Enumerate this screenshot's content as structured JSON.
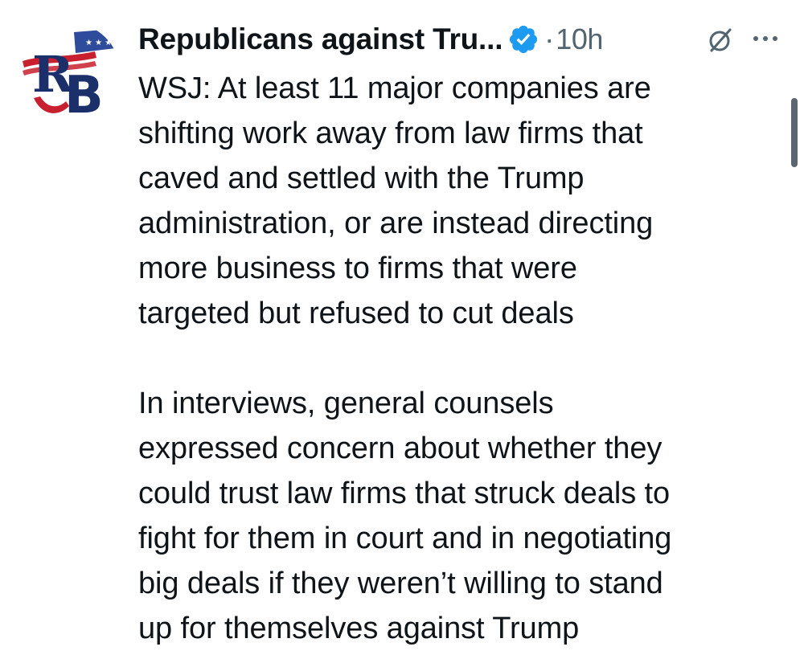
{
  "tweet": {
    "author": {
      "display_name": "Republicans against Tru...",
      "verified": true,
      "avatar_icon": "rb-logo-avatar",
      "avatar_text": "RB"
    },
    "meta": {
      "separator": "·",
      "timestamp": "10h"
    },
    "icons": {
      "verified": "verified-badge-icon",
      "grok": "grok-icon",
      "more": "more-options-icon"
    },
    "body": {
      "paragraphs": [
        "WSJ: At least 11 major companies are\nshifting work away from law firms that\ncaved and settled with the Trump\nadministration, or are instead directing\nmore business to firms that were\ntargeted but refused to cut deals",
        "In interviews, general counsels\nexpressed concern about whether they\ncould trust law firms that struck deals to\nfight for them in court and in negotiating\nbig deals if they weren’t willing to stand\nup for themselves against Trump"
      ]
    }
  },
  "colors": {
    "text_primary": "#0f1419",
    "text_secondary": "#536471",
    "verified_blue": "#1d9bf0",
    "logo_red": "#c8202f",
    "logo_blue": "#1b2f6b",
    "background": "#ffffff"
  }
}
